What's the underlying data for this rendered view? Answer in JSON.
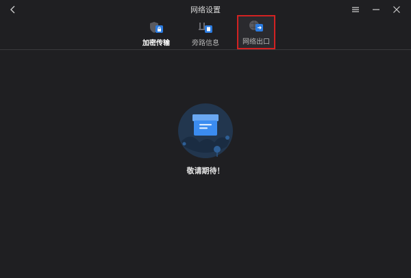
{
  "window": {
    "title": "网络设置"
  },
  "tabs": [
    {
      "label": "加密传输",
      "icon": "encrypted-shield-icon"
    },
    {
      "label": "旁路信息",
      "icon": "bypass-info-icon"
    },
    {
      "label": "网络出口",
      "icon": "network-exit-icon"
    }
  ],
  "content": {
    "message": "敬请期待！"
  },
  "colors": {
    "background": "#1f1f22",
    "accent": "#2b7be0",
    "highlight_border": "#d42222"
  }
}
